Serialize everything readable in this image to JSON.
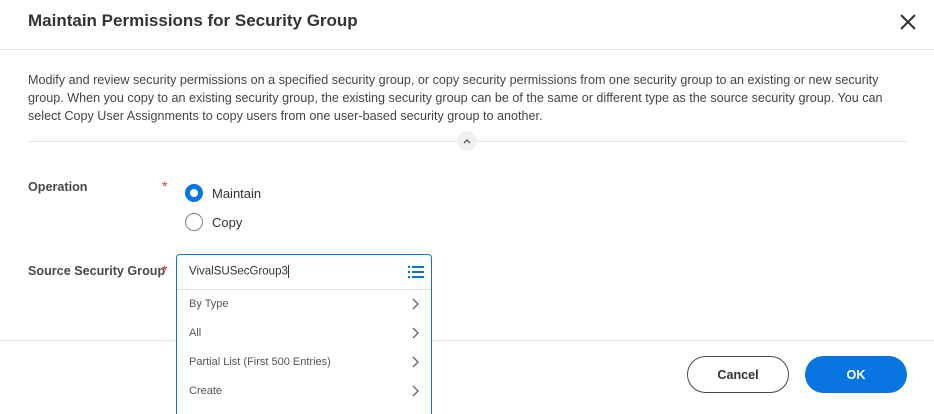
{
  "dialog": {
    "title": "Maintain Permissions for Security Group",
    "description": "Modify and review security permissions on a specified security group, or copy security permissions from one security group to an existing or new security group. When you copy to an existing security group, the existing security group can be of the same or different type as the source security group. You can select Copy User Assignments to copy users from one user-based security group to another."
  },
  "form": {
    "operation": {
      "label": "Operation",
      "required_mark": "*",
      "options": [
        {
          "label": "Maintain",
          "selected": true
        },
        {
          "label": "Copy",
          "selected": false
        }
      ]
    },
    "source_group": {
      "label": "Source Security Group",
      "required_mark": "*",
      "value": "VivalSUSecGroup3",
      "menu": [
        "By Type",
        "All",
        "Partial List (First 500 Entries)",
        "Create"
      ]
    }
  },
  "footer": {
    "cancel": "Cancel",
    "ok": "OK"
  },
  "colors": {
    "accent": "#0875e1",
    "required": "#de2e21"
  }
}
